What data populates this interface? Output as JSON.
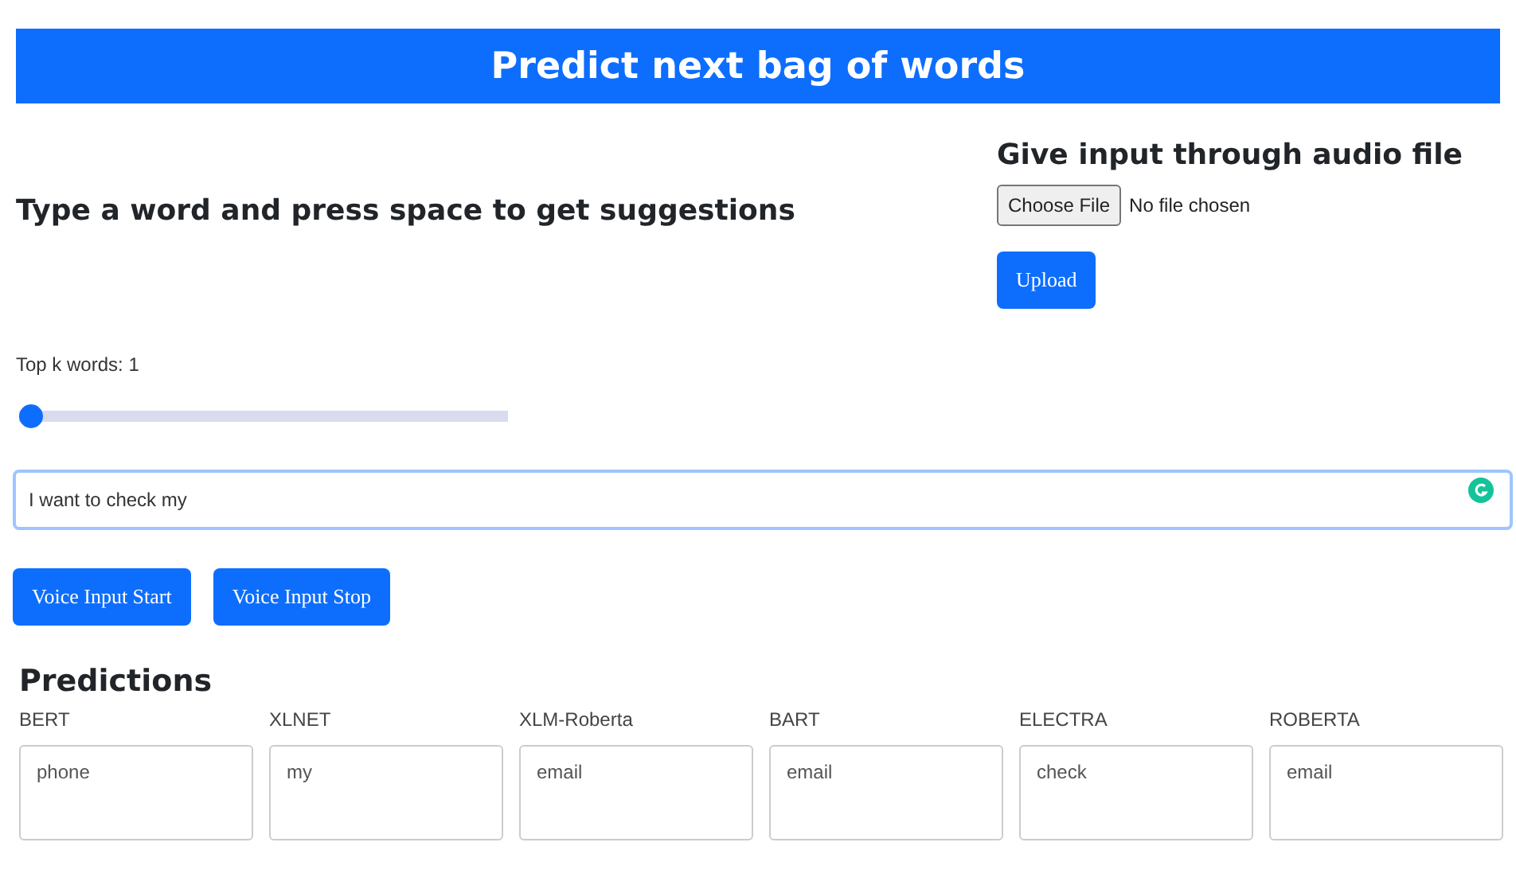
{
  "header": {
    "title": "Predict next bag of words"
  },
  "prompt": {
    "heading": "Type a word and press space to get suggestions"
  },
  "audio": {
    "heading": "Give input through audio file",
    "choose_button": "Choose File",
    "file_status": "No file chosen",
    "upload_button": "Upload"
  },
  "slider": {
    "label": "Top k words: 1",
    "level": 0
  },
  "input": {
    "value": "I want to check my "
  },
  "voice_buttons": [
    "Voice Input Start",
    "Voice Input Stop"
  ],
  "predictions": {
    "heading": "Predictions",
    "models": [
      {
        "name": "BERT",
        "word": "phone"
      },
      {
        "name": "XLNET",
        "word": "my"
      },
      {
        "name": "XLM-Roberta",
        "word": "email"
      },
      {
        "name": "BART",
        "word": "email"
      },
      {
        "name": "ELECTRA",
        "word": "check"
      },
      {
        "name": "ROBERTA",
        "word": "email"
      }
    ]
  }
}
